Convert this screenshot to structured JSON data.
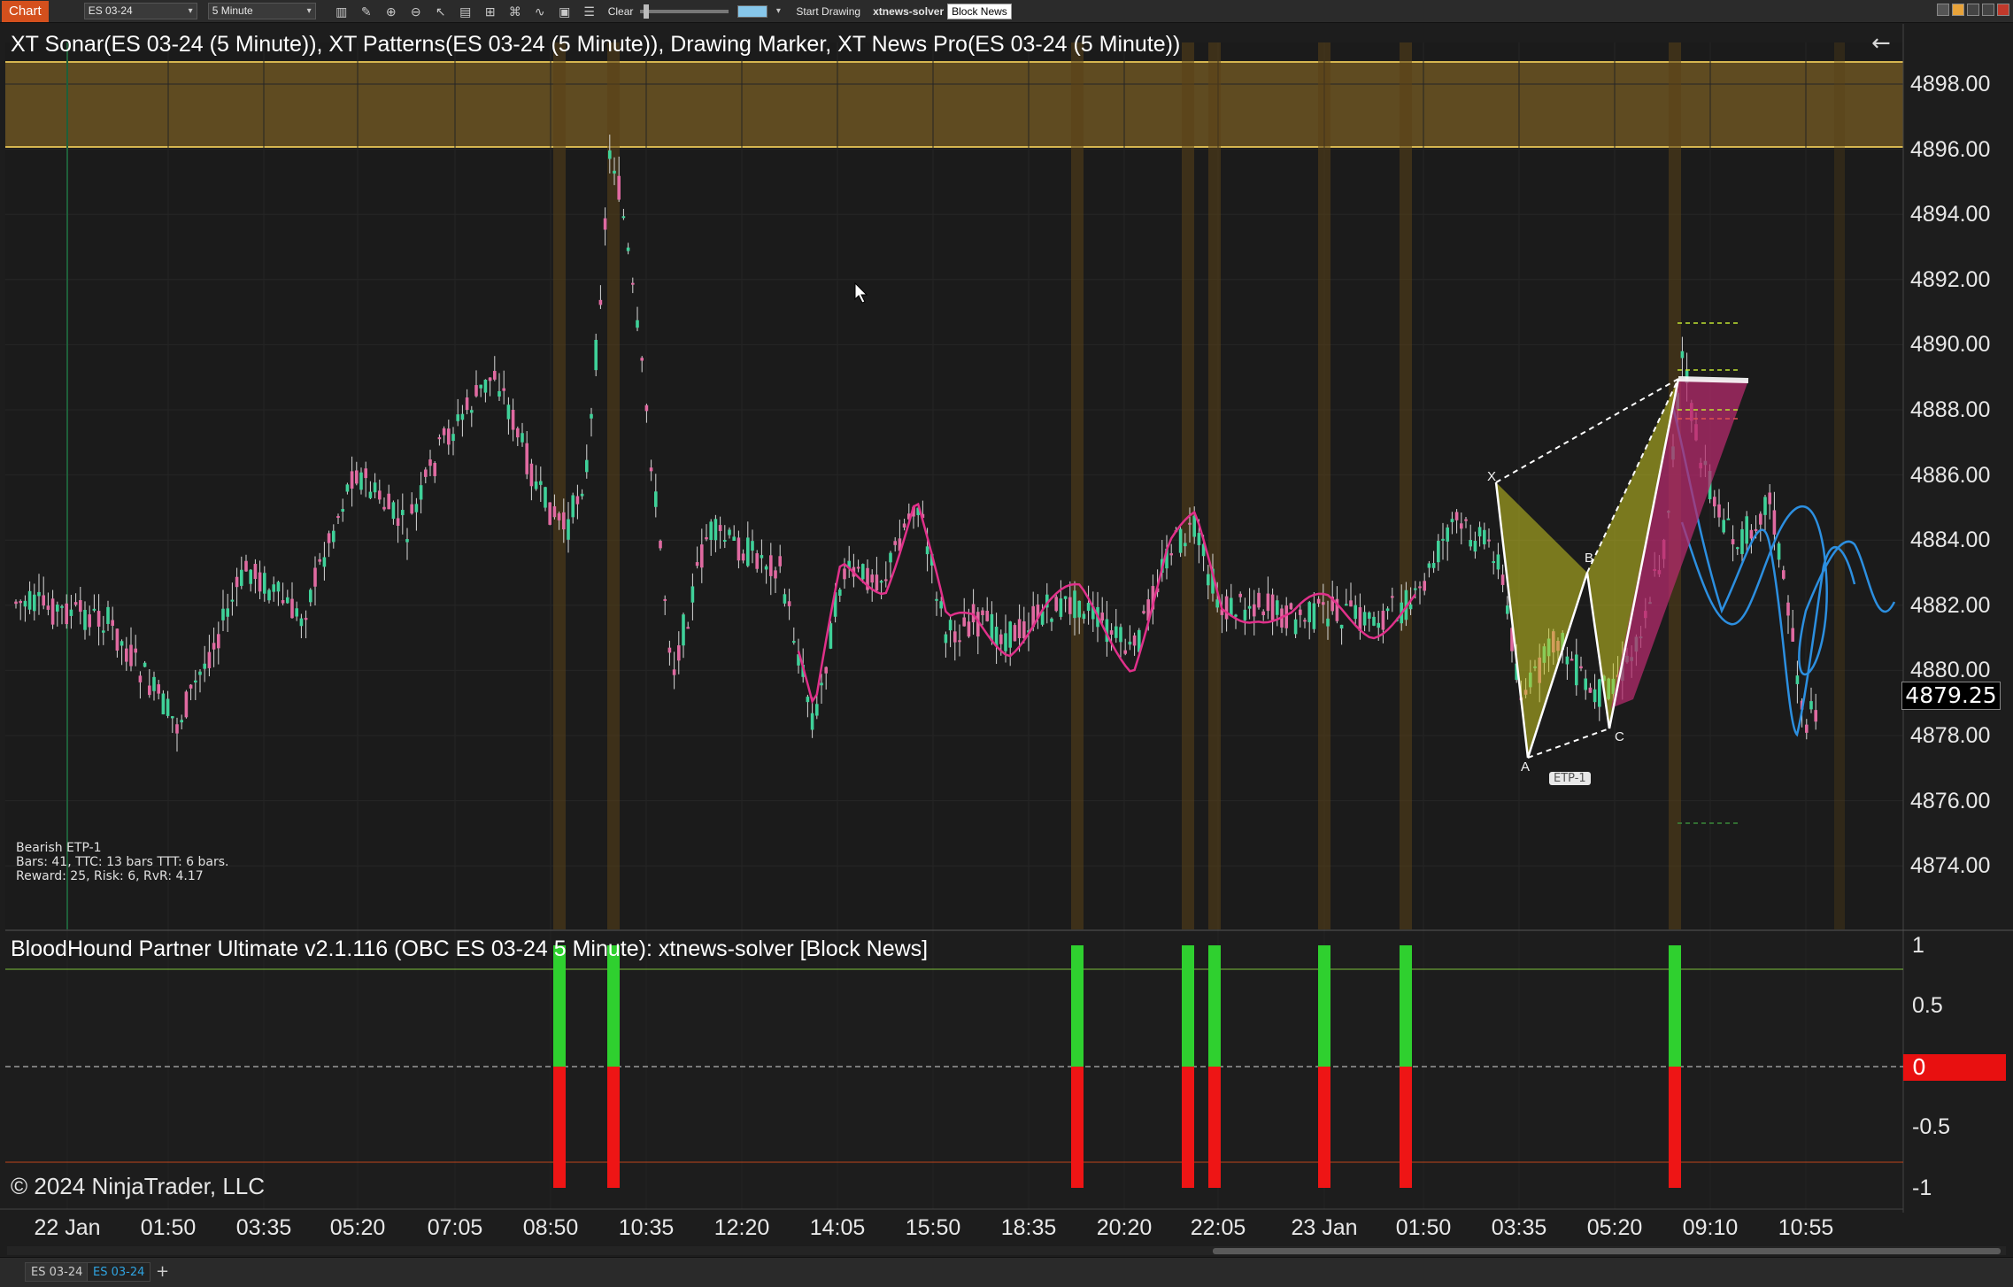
{
  "toolbar": {
    "chart_tab": "Chart",
    "instrument": "ES 03-24",
    "interval": "5 Minute",
    "clear_label": "Clear",
    "start_drawing": "Start Drawing",
    "xtnews_label": "xtnews-solver",
    "block_news": "Block News"
  },
  "chart": {
    "title": "XT Sonar(ES 03-24 (5 Minute)), XT Patterns(ES 03-24 (5 Minute)), Drawing Marker, XT News Pro(ES 03-24 (5 Minute))",
    "price_axis": [
      "4898.00",
      "4896.00",
      "4894.00",
      "4892.00",
      "4890.00",
      "4888.00",
      "4886.00",
      "4884.00",
      "4882.00",
      "4880.00",
      "4878.00",
      "4876.00",
      "4874.00"
    ],
    "current_price": "4879.25",
    "pattern_points": {
      "x": "X",
      "a": "A",
      "b": "B",
      "c": "C",
      "etp": "ETP-1"
    },
    "info": {
      "line1": "Bearish ETP-1",
      "line2": "Bars: 41, TTC: 13 bars  TTT: 6 bars.",
      "line3": "Reward: 25, Risk: 6, RvR: 4.17"
    },
    "colors": {
      "zone": "#6b5422",
      "bull": "#3fd199",
      "bear": "#e06aa1",
      "sonar": "#e0308a",
      "projection": "#2c8fe0"
    }
  },
  "indicator": {
    "title": "BloodHound Partner Ultimate v2.1.116 (OBC ES 03-24 5 Minute): xtnews-solver  [Block News]",
    "axis": [
      "1",
      "0.5",
      "0",
      "-0.5",
      "-1"
    ],
    "zero_label": "0",
    "copyright": "© 2024 NinjaTrader, LLC"
  },
  "time_axis": [
    "22 Jan",
    "01:50",
    "03:35",
    "05:20",
    "07:05",
    "08:50",
    "10:35",
    "12:20",
    "14:05",
    "15:50",
    "18:35",
    "20:20",
    "22:05",
    "23 Jan",
    "01:50",
    "03:35",
    "05:20",
    "09:10",
    "10:55"
  ],
  "bottom_tabs": [
    "ES 03-24",
    "ES 03-24"
  ]
}
